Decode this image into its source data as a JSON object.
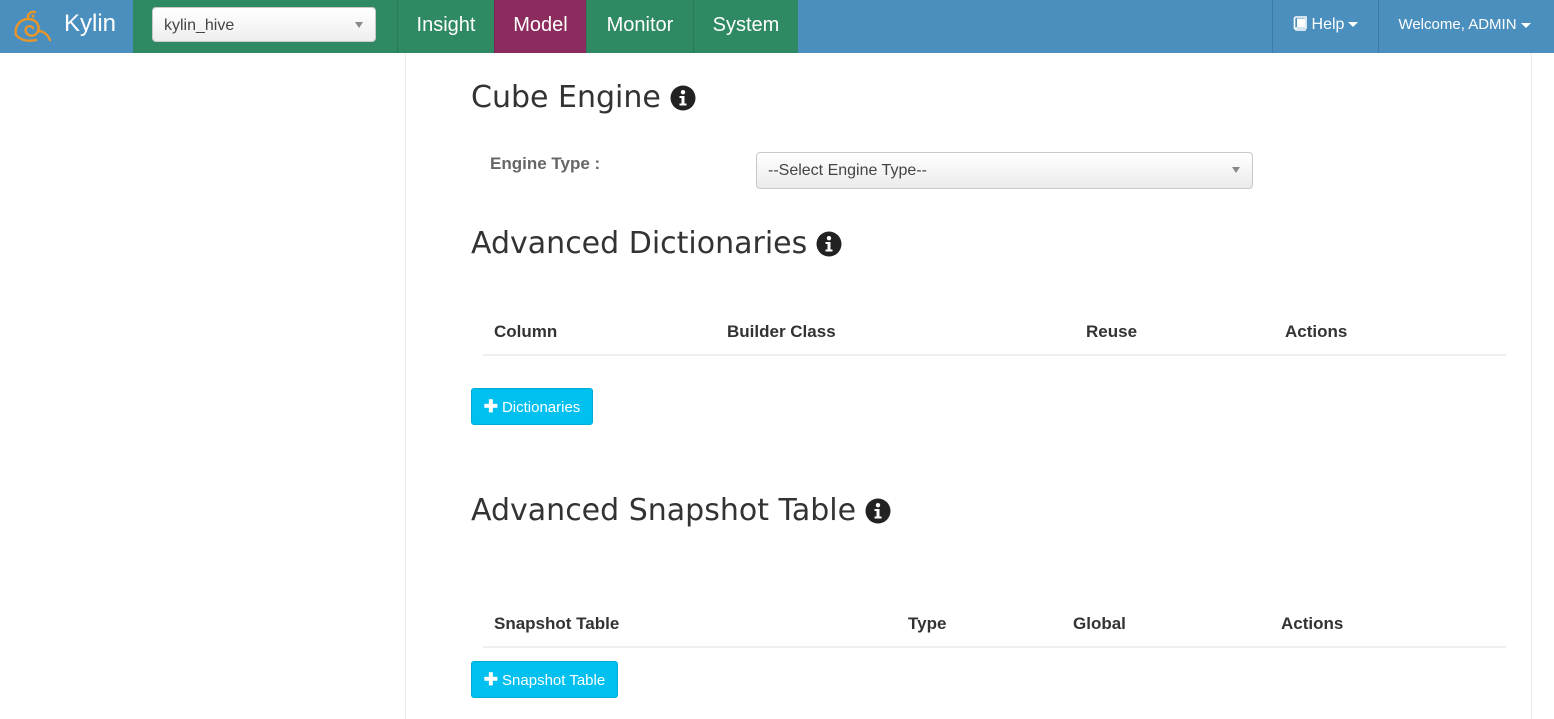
{
  "navbar": {
    "brand": "Kylin",
    "project_select": {
      "value": "kylin_hive"
    },
    "tabs": [
      {
        "label": "Insight",
        "active": false
      },
      {
        "label": "Model",
        "active": true
      },
      {
        "label": "Monitor",
        "active": false
      },
      {
        "label": "System",
        "active": false
      }
    ],
    "help_label": "Help",
    "user_label": "Welcome, ADMIN"
  },
  "cube_engine": {
    "title": "Cube Engine",
    "engine_type_label": "Engine Type :",
    "engine_type_value": "--Select Engine Type--"
  },
  "dictionaries": {
    "title": "Advanced Dictionaries",
    "columns": [
      "Column",
      "Builder Class",
      "Reuse",
      "Actions"
    ],
    "add_button": "Dictionaries"
  },
  "snapshot": {
    "title": "Advanced Snapshot Table",
    "columns": [
      "Snapshot Table",
      "Type",
      "Global",
      "Actions"
    ],
    "add_button": "Snapshot Table"
  },
  "colors": {
    "navbar_blue": "#4a8fbe",
    "nav_green": "#2f8a63",
    "active_tab": "#8c2c5e",
    "add_button": "#00c0ef"
  },
  "icons": [
    "kylin-logo-icon",
    "chevron-down-icon",
    "book-icon",
    "info-icon",
    "plus-icon"
  ]
}
